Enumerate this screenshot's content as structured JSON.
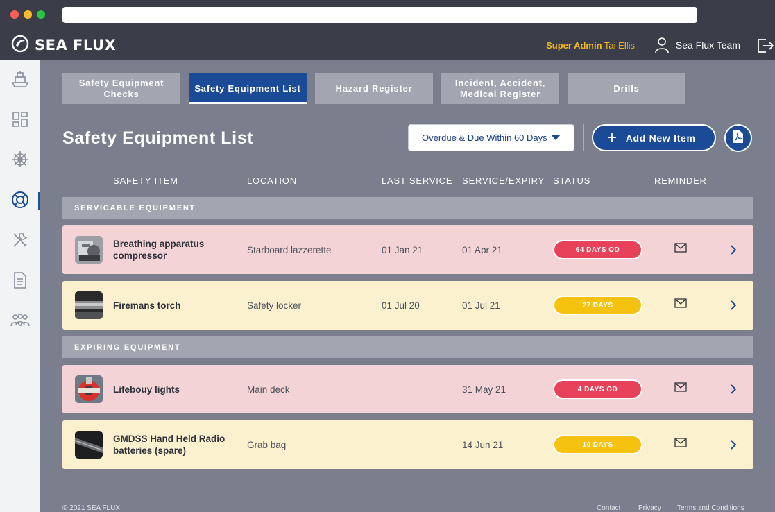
{
  "app": {
    "brand": "SEA FLUX",
    "role_label": "Super Admin",
    "user_name": "Tai Ellis",
    "team_name": "Sea Flux Team"
  },
  "tabs": [
    {
      "label": "Safety Equipment Checks",
      "active": false
    },
    {
      "label": "Safety Equipment List",
      "active": true
    },
    {
      "label": "Hazard Register",
      "active": false
    },
    {
      "label": "Incident, Accident, Medical Register",
      "active": false
    },
    {
      "label": "Drills",
      "active": false
    }
  ],
  "page": {
    "title": "Safety Equipment List",
    "filter_label": "Overdue & Due Within 60 Days",
    "add_button_label": "Add New Item"
  },
  "columns": [
    "SAFETY ITEM",
    "LOCATION",
    "LAST SERVICE",
    "SERVICE/EXPIRY",
    "STATUS",
    "REMINDER"
  ],
  "sections": [
    {
      "title": "SERVICABLE EQUIPMENT",
      "rows": [
        {
          "name": "Breathing apparatus compressor",
          "location": "Starboard lazzerette",
          "last_service": "01 Jan 21",
          "expiry": "01 Apr 21",
          "status": "64 DAYS OD",
          "status_kind": "overdue"
        },
        {
          "name": "Firemans torch",
          "location": "Safety locker",
          "last_service": "01 Jul 20",
          "expiry": "01 Jul 21",
          "status": "27 DAYS",
          "status_kind": "due"
        }
      ]
    },
    {
      "title": "EXPIRING EQUIPMENT",
      "rows": [
        {
          "name": "Lifebouy lights",
          "location": "Main deck",
          "last_service": "",
          "expiry": "31 May 21",
          "status": "4 DAYS OD",
          "status_kind": "overdue"
        },
        {
          "name": "GMDSS Hand Held Radio batteries (spare)",
          "location": "Grab bag",
          "last_service": "",
          "expiry": "14 Jun 21",
          "status": "10 DAYS",
          "status_kind": "due"
        }
      ]
    }
  ],
  "footer": {
    "copyright": "© 2021 SEA FLUX",
    "links": [
      "Contact",
      "Privacy",
      "Terms and Conditions"
    ]
  },
  "colors": {
    "primary": "#1b4a97",
    "overdue_row": "#f4d3d6",
    "due_row": "#fcf1cf",
    "overdue_badge": "#e7425a",
    "due_badge": "#f5c30f",
    "accent_gold": "#f5b81c"
  },
  "icons": {
    "sidebar": [
      "vessel-icon",
      "dashboard-icon",
      "helm-icon",
      "lifebuoy-icon",
      "tools-icon",
      "document-icon",
      "crew-icon"
    ]
  }
}
